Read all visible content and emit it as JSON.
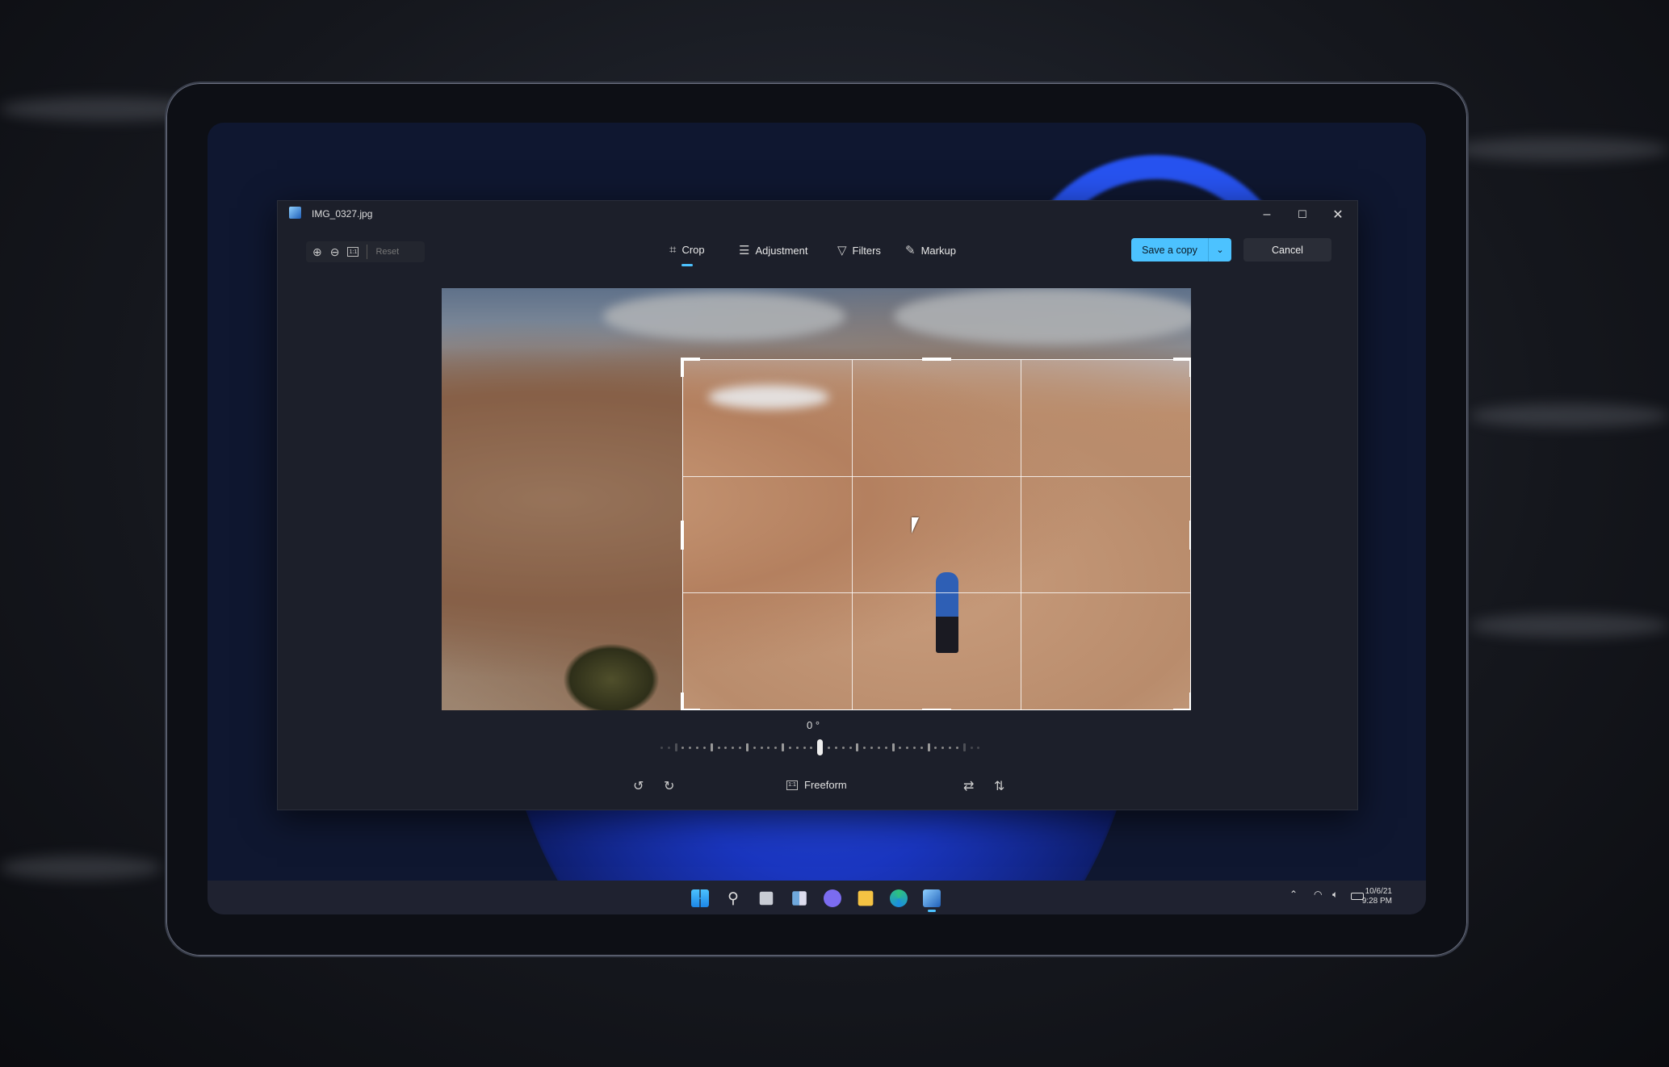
{
  "window": {
    "title": "IMG_0327.jpg",
    "minimize": "–",
    "maximize": "☐",
    "close": "✕"
  },
  "toolbar": {
    "zoom_in": "⊕",
    "zoom_out": "⊖",
    "actual_size": "1:1",
    "reset": "Reset",
    "tabs": [
      {
        "label": "Crop",
        "icon": "crop-icon",
        "active": true
      },
      {
        "label": "Adjustment",
        "icon": "sliders-icon"
      },
      {
        "label": "Filters",
        "icon": "filter-icon"
      },
      {
        "label": "Markup",
        "icon": "pen-icon"
      }
    ],
    "save": "Save a copy",
    "save_dropdown": "⌄",
    "cancel": "Cancel"
  },
  "editor": {
    "angle": "0 °",
    "straighten_value_degrees": 0,
    "aspect": "Freeform",
    "aspect_icon": "1:1"
  },
  "taskbar": {
    "date": "10/6/21",
    "time": "9:28 PM",
    "accent": "#4cc2ff"
  }
}
